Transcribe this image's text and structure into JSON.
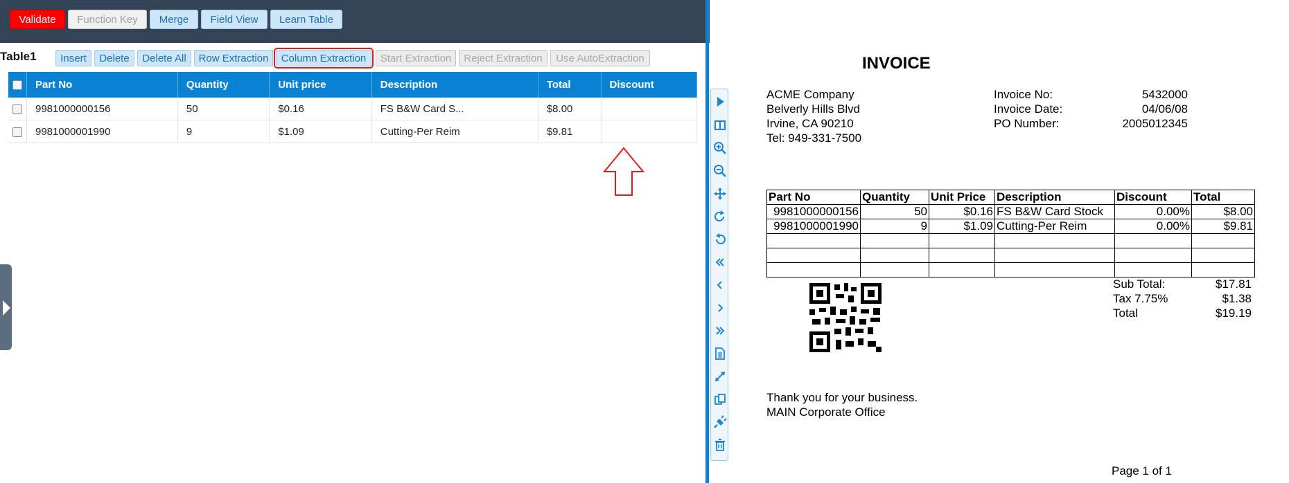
{
  "toolbar": {
    "validate": "Validate",
    "function_key": "Function Key",
    "merge": "Merge",
    "field_view": "Field View",
    "learn_table": "Learn Table"
  },
  "table_toolbar": {
    "label": "Table1",
    "insert": "Insert",
    "delete": "Delete",
    "delete_all": "Delete All",
    "row_extraction": "Row Extraction",
    "column_extraction": "Column Extraction",
    "start_extraction": "Start Extraction",
    "reject_extraction": "Reject Extraction",
    "use_autoextraction": "Use AutoExtraction"
  },
  "table": {
    "headers": [
      "Part No",
      "Quantity",
      "Unit price",
      "Description",
      "Total",
      "Discount"
    ],
    "rows": [
      [
        "9981000000156",
        "50",
        "$0.16",
        "FS B&W Card S...",
        "$8.00",
        ""
      ],
      [
        "9981000001990",
        "9",
        "$1.09",
        "Cutting-Per Reim",
        "$9.81",
        ""
      ]
    ]
  },
  "viewer_icons": [
    "play-icon",
    "split-view-icon",
    "zoom-in-icon",
    "zoom-out-icon",
    "move-icon",
    "rotate-cw-icon",
    "rotate-ccw-icon",
    "first-page-icon",
    "prev-page-icon",
    "next-page-icon",
    "last-page-icon",
    "document-icon",
    "fit-icon",
    "copy-icon",
    "plugin-icon",
    "trash-icon"
  ],
  "invoice": {
    "title": "INVOICE",
    "company": [
      "ACME Company",
      "Belverly Hills Blvd",
      "Irvine, CA 90210",
      "Tel: 949-331-7500"
    ],
    "meta_labels": [
      "Invoice No:",
      "Invoice Date:",
      "PO Number:"
    ],
    "meta_values": [
      "5432000",
      "04/06/08",
      "2005012345"
    ],
    "headers": [
      "Part No",
      "Quantity",
      "Unit Price",
      "Description",
      "Discount",
      "Total"
    ],
    "rows": [
      [
        "9981000000156",
        "50",
        "$0.16",
        "FS B&W Card Stock",
        "0.00%",
        "$8.00"
      ],
      [
        "9981000001990",
        "9",
        "$1.09",
        "Cutting-Per Reim",
        "0.00%",
        "$9.81"
      ]
    ],
    "summary_labels": [
      "Sub Total:",
      "Tax 7.75%",
      "Total"
    ],
    "summary_values": [
      "$17.81",
      "$1.38",
      "$19.19"
    ],
    "footer": [
      "Thank you for your business.",
      "MAIN Corporate Office"
    ],
    "page": "Page 1 of 1"
  },
  "colors": {
    "header_bar": "#334358",
    "table_header": "#0a82d4",
    "validate": "#ff0000",
    "highlight": "#e01b1b"
  }
}
